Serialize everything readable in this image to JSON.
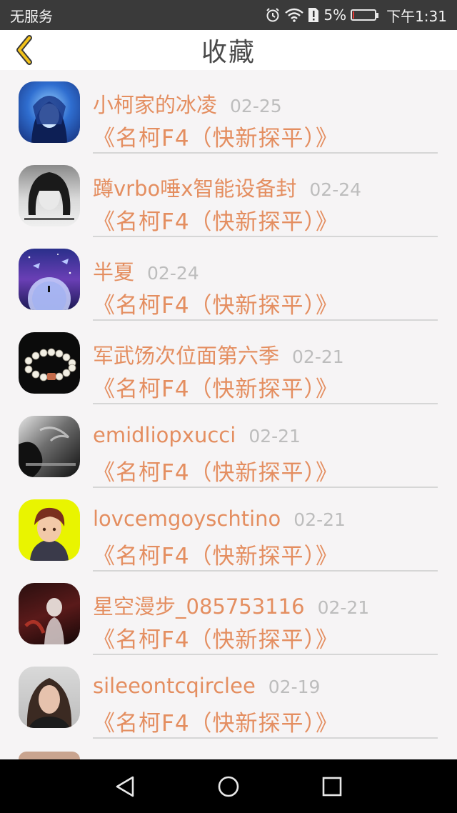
{
  "status_bar": {
    "carrier": "无服务",
    "battery_percent": "5%",
    "battery_level": 0.05,
    "time": "下午1:31",
    "icons": [
      "alarm-icon",
      "wifi-icon",
      "sim-alert-icon",
      "battery-icon"
    ]
  },
  "header": {
    "title": "收藏",
    "back_icon": "chevron-left-icon",
    "accent_color": "#f2c21b"
  },
  "favorites": [
    {
      "user": "小柯家的冰凌",
      "date": "02-25",
      "work": "《名柯F4（快新探平）》",
      "avatar": "avatar-anime-girl-blue"
    },
    {
      "user": "蹲vrbo唾x智能设备封",
      "date": "02-24",
      "work": "《名柯F4（快新探平）》",
      "avatar": "avatar-bw-girl-text"
    },
    {
      "user": "半夏",
      "date": "02-24",
      "work": "《名柯F4（快新探平）》",
      "avatar": "avatar-moon-night-sky"
    },
    {
      "user": "军武饧次位面第六季",
      "date": "02-21",
      "work": "《名柯F4（快新探平）》",
      "avatar": "avatar-pearl-bracelet"
    },
    {
      "user": "emidliopxucci",
      "date": "02-21",
      "work": "《名柯F4（快新探平）》",
      "avatar": "avatar-bw-smoke-text"
    },
    {
      "user": "lovcemgoyschtino",
      "date": "02-21",
      "work": "《名柯F4（快新探平）》",
      "avatar": "avatar-anime-boy-yellow"
    },
    {
      "user": "星空漫步_085753116",
      "date": "02-21",
      "work": "《名柯F4（快新探平）》",
      "avatar": "avatar-dark-red-figure"
    },
    {
      "user": "sileeontcqirclee",
      "date": "02-19",
      "work": "《名柯F4（快新探平）》",
      "avatar": "avatar-woman-portrait"
    }
  ],
  "colors": {
    "name_color": "#e48e60",
    "date_color": "#bdbdbd",
    "title_color": "#4a4a4a"
  },
  "nav_bar": {
    "buttons": [
      "back-triangle-icon",
      "home-circle-icon",
      "recents-square-icon"
    ]
  }
}
